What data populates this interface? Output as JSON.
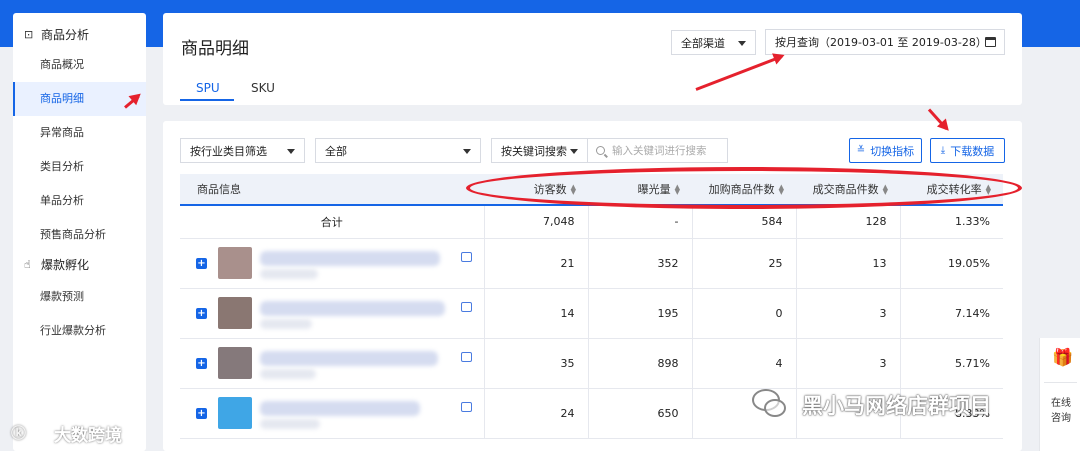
{
  "sidebar": {
    "groups": [
      {
        "icon": "shopping-bag-icon",
        "label": "商品分析",
        "items": [
          "商品概况",
          "商品明细",
          "异常商品",
          "类目分析",
          "单品分析",
          "预售商品分析"
        ],
        "active_index": 1
      },
      {
        "icon": "hand-icon",
        "label": "爆款孵化",
        "items": [
          "爆款预测",
          "行业爆款分析"
        ]
      }
    ]
  },
  "header": {
    "title": "商品明细",
    "channel_select": "全部渠道",
    "date_range": "按月查询（2019-03-01 至 2019-03-28）",
    "tabs": [
      "SPU",
      "SKU"
    ],
    "active_tab": 0
  },
  "filters": {
    "industry_filter": "按行业类目筛选",
    "category_value": "全部",
    "keyword_mode": "按关键词搜索",
    "search_placeholder": "输入关键词进行搜索",
    "switch_metric_label": "切换指标",
    "download_label": "下载数据"
  },
  "table": {
    "columns": [
      "商品信息",
      "访客数",
      "曝光量",
      "加购商品件数",
      "成交商品件数",
      "成交转化率"
    ],
    "total": {
      "label": "合计",
      "values": [
        "7,048",
        "-",
        "584",
        "128",
        "1.33%"
      ]
    },
    "rows": [
      {
        "values": [
          "21",
          "352",
          "25",
          "13",
          "19.05%"
        ],
        "thumb_color": "#a9908c"
      },
      {
        "values": [
          "14",
          "195",
          "0",
          "3",
          "7.14%"
        ],
        "thumb_color": "#8a7772"
      },
      {
        "values": [
          "35",
          "898",
          "4",
          "3",
          "5.71%"
        ],
        "thumb_color": "#85797b"
      },
      {
        "values": [
          "24",
          "650",
          "",
          "",
          "8.33%"
        ],
        "thumb_color": "#3fa6e6"
      }
    ]
  },
  "float_panel": {
    "icon": "gift-icon",
    "label": "在线咨询"
  },
  "watermarks": {
    "bottom_left": "大数跨境",
    "right": "黑小马网络店群项目"
  },
  "colors": {
    "brand": "#1565e6",
    "annotation": "#e5212d"
  }
}
